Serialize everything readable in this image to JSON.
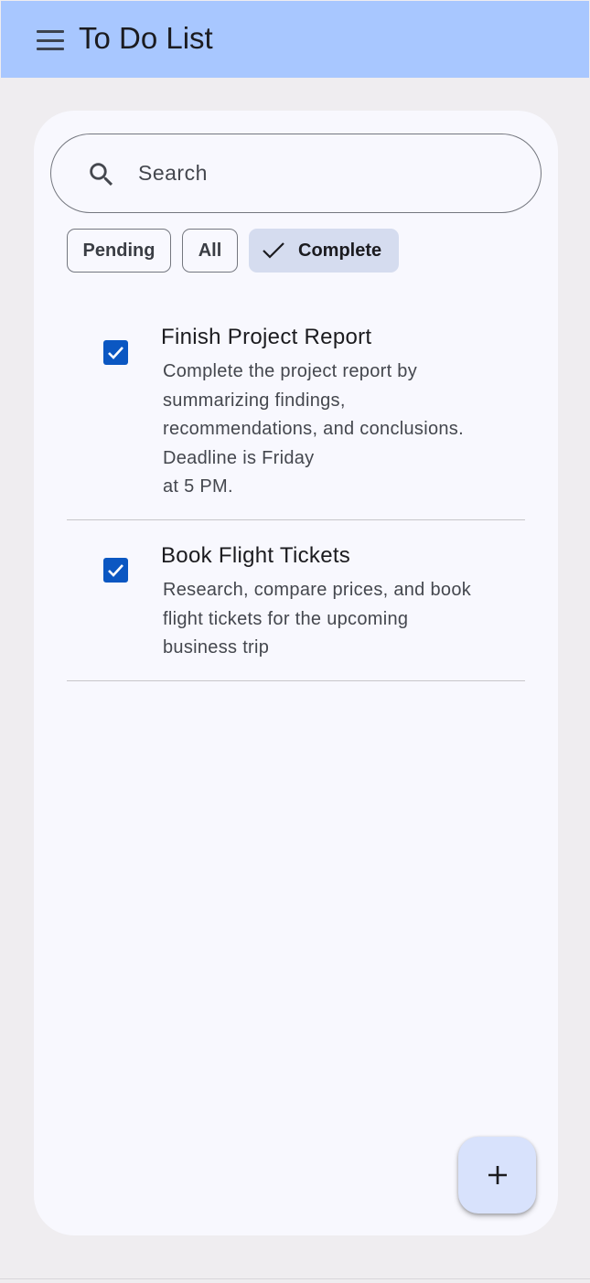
{
  "app_bar": {
    "title": "To Do List",
    "menu_icon": "menu-icon",
    "background": "#a8c7ff"
  },
  "search": {
    "placeholder": "Search",
    "value": "",
    "icon": "search-icon"
  },
  "filters": {
    "chips": [
      {
        "label": "Pending",
        "selected": false
      },
      {
        "label": "All",
        "selected": false
      },
      {
        "label": "Complete",
        "selected": true
      }
    ]
  },
  "tasks": [
    {
      "title": "Finish Project Report",
      "description": "Complete the project report by\nsummarizing findings,\nrecommendations, and conclusions.\nDeadline is Friday\nat 5 PM.",
      "checked": true
    },
    {
      "title": "Book Flight Tickets",
      "description": "Research, compare prices, and book\nflight tickets for the upcoming\nbusiness trip",
      "checked": true
    }
  ],
  "fab": {
    "icon": "plus-icon"
  },
  "colors": {
    "accent": "#0b57c2",
    "chip_selected": "#d5dcef",
    "fab": "#d8e2fc",
    "card": "#f8f8fe",
    "background": "#efedf0"
  }
}
